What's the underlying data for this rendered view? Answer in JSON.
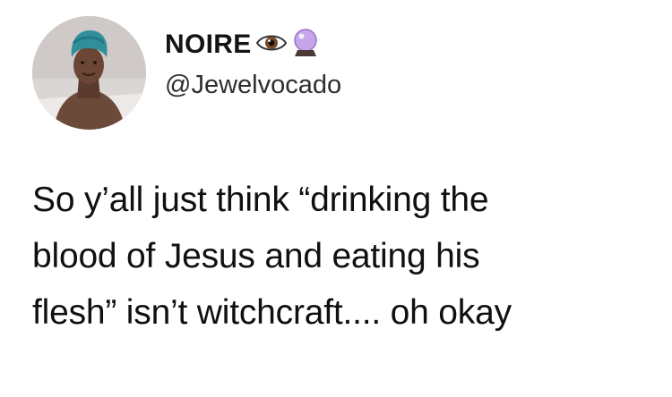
{
  "author": {
    "display_name": "NOIRE",
    "name_emojis": [
      "eye-icon",
      "crystal-ball-icon"
    ],
    "handle": "@Jewelvocado"
  },
  "tweet": {
    "lines": [
      "So y’all just think “drinking the",
      "blood of Jesus and eating his",
      "flesh” isn’t witchcraft.... oh okay"
    ]
  },
  "colors": {
    "background": "#ffffff",
    "text": "#111111",
    "crystal_ball": "#c6a6e8",
    "avatar_turban": "#2f8f9a"
  }
}
